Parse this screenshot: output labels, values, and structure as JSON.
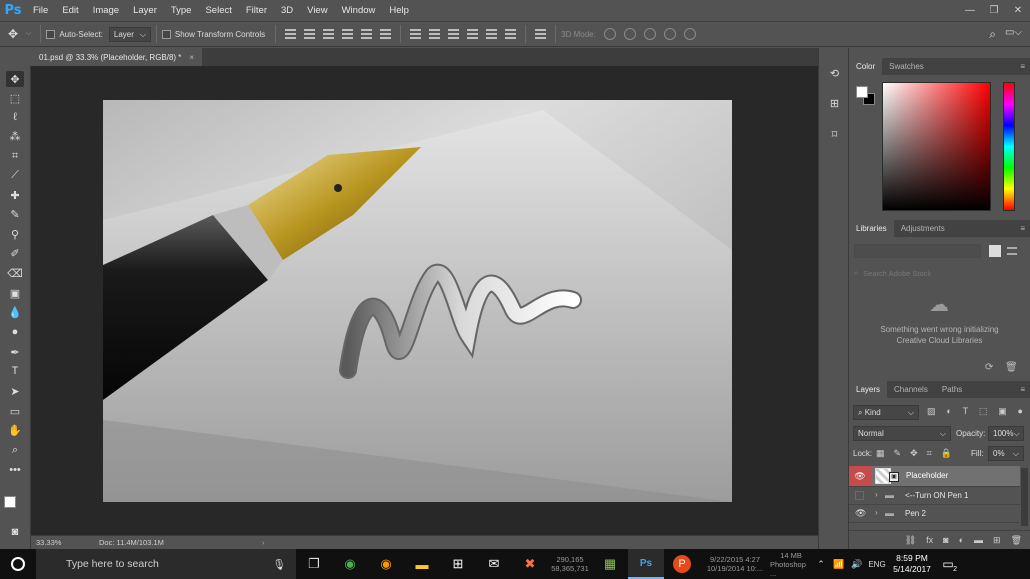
{
  "app": {
    "logo": "Ps",
    "menu": [
      "File",
      "Edit",
      "Image",
      "Layer",
      "Type",
      "Select",
      "Filter",
      "3D",
      "View",
      "Window",
      "Help"
    ],
    "window_controls": [
      "—",
      "❐",
      "✕"
    ]
  },
  "options_bar": {
    "auto_select_label": "Auto-Select:",
    "auto_select_value": "Layer",
    "show_transform_label": "Show Transform Controls",
    "mode_3d_label": "3D Mode:"
  },
  "document": {
    "tab_title": "01.psd @ 33.3% (Placeholder, RGB/8) *",
    "close": "×",
    "zoom": "33.33%",
    "doc_info": "Doc: 11.4M/103.1M"
  },
  "color_panel": {
    "tabs": [
      "Color",
      "Swatches"
    ],
    "hue_color": "#ff0000"
  },
  "libraries_panel": {
    "tabs": [
      "Libraries",
      "Adjustments"
    ],
    "search_placeholder": "Search Adobe Stock",
    "error_line1": "Something went wrong initializing",
    "error_line2": "Creative Cloud Libraries"
  },
  "layers_panel": {
    "tabs": [
      "Layers",
      "Channels",
      "Paths"
    ],
    "filter_kind": "Kind",
    "blend_mode": "Normal",
    "opacity_label": "Opacity:",
    "opacity_value": "100%",
    "lock_label": "Lock:",
    "fill_label": "Fill:",
    "fill_value": "0%",
    "layers": [
      {
        "name": "Placeholder",
        "visible": true,
        "selected": true
      },
      {
        "name": "<--Turn ON Pen 1",
        "visible": false,
        "selected": false
      },
      {
        "name": "Pen 2",
        "visible": true,
        "selected": false
      }
    ]
  },
  "taskbar": {
    "search_placeholder": "Type here to search",
    "time": "8:59 PM",
    "date": "5/14/2017",
    "notification_count": "2",
    "ime": "ENG",
    "tray_fragments": {
      "a": "290,165",
      "b": "58,365,731",
      "c": "9/22/2015 4:27",
      "d": "10/19/2014 10:...",
      "e": "Photoshop ...",
      "f": "14 MB"
    }
  }
}
